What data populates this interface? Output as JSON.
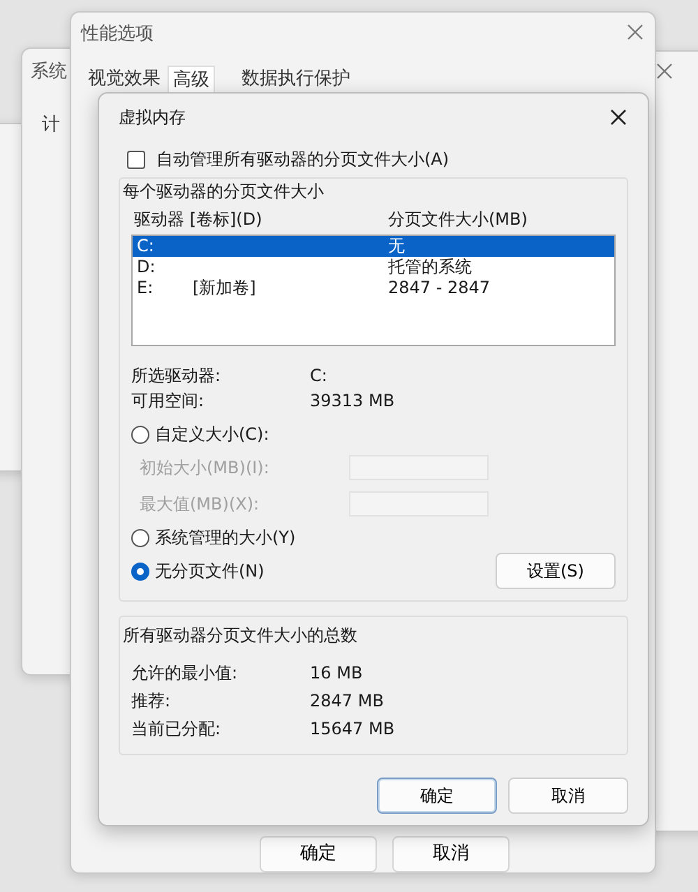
{
  "background_windows": {
    "system": {
      "title": "系统",
      "texts": [
        "计"
      ]
    },
    "performance_options": {
      "title": "性能选项",
      "tabs": [
        {
          "label": "视觉效果",
          "selected": false
        },
        {
          "label": "高级",
          "selected": true
        },
        {
          "label": "数据执行保护",
          "selected": false
        }
      ],
      "buttons": [
        "确定",
        "取消"
      ]
    }
  },
  "dialog": {
    "title": "虚拟内存",
    "auto_manage": {
      "label": "自动管理所有驱动器的分页文件大小(A)",
      "checked": false
    },
    "per_drive": {
      "title": "每个驱动器的分页文件大小",
      "columns": [
        "驱动器 [卷标](D)",
        "分页文件大小(MB)"
      ],
      "rows": [
        {
          "drive": "C:",
          "label": "",
          "size": "无",
          "selected": true
        },
        {
          "drive": "D:",
          "label": "",
          "size": "托管的系统",
          "selected": false
        },
        {
          "drive": "E:",
          "label": "[新加卷]",
          "size": "2847 - 2847",
          "selected": false
        }
      ],
      "info": [
        {
          "label": "所选驱动器:",
          "value": "C:"
        },
        {
          "label": "可用空间:",
          "value": "39313 MB"
        }
      ],
      "options": [
        {
          "label": "自定义大小(C):",
          "selected": false
        },
        {
          "label": "系统管理的大小(Y)",
          "selected": false
        },
        {
          "label": "无分页文件(N)",
          "selected": true
        }
      ],
      "fields": [
        {
          "label": "初始大小(MB)(I):",
          "disabled": true
        },
        {
          "label": "最大值(MB)(X):",
          "disabled": true
        }
      ],
      "set_button": "设置(S)"
    },
    "totals": {
      "title": "所有驱动器分页文件大小的总数",
      "rows": [
        {
          "label": "允许的最小值:",
          "value": "16 MB"
        },
        {
          "label": "推荐:",
          "value": "2847 MB"
        },
        {
          "label": "当前已分配:",
          "value": "15647 MB"
        }
      ]
    },
    "buttons": [
      {
        "label": "确定",
        "primary": true
      },
      {
        "label": "取消",
        "primary": false
      }
    ]
  }
}
